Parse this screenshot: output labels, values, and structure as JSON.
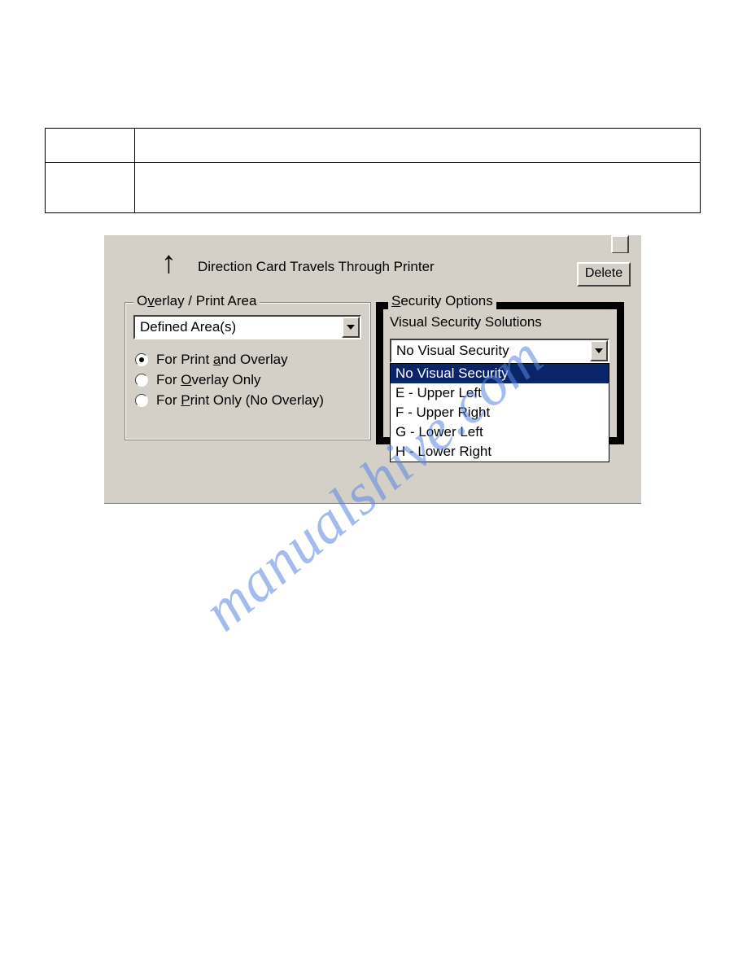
{
  "watermark": "manualshive.com",
  "direction_label": "Direction Card Travels Through Printer",
  "delete_button": "Delete",
  "overlay_group": {
    "legend_pre": "O",
    "legend_u": "v",
    "legend_post": "erlay / Print Area",
    "combo_value": "Defined Area(s)",
    "radios": [
      {
        "pre": "For Print ",
        "u": "a",
        "post": "nd Overlay",
        "checked": true
      },
      {
        "pre": "For ",
        "u": "O",
        "post": "verlay Only",
        "checked": false
      },
      {
        "pre": "For ",
        "u": "P",
        "post": "rint Only (No Overlay)",
        "checked": false
      }
    ]
  },
  "security_group": {
    "legend_u": "S",
    "legend_post": "ecurity Options",
    "sub_label": "Visual Security Solutions",
    "combo_value": "No Visual Security",
    "options": [
      {
        "label": "No Visual Security",
        "selected": true
      },
      {
        "label": "E - Upper Left",
        "selected": false
      },
      {
        "label": "F - Upper Right",
        "selected": false
      },
      {
        "label": "G - Lower Left",
        "selected": false
      },
      {
        "label": "H - Lower Right",
        "selected": false
      }
    ]
  }
}
